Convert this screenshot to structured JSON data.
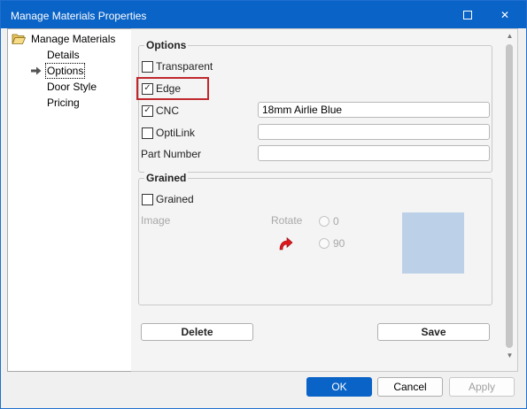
{
  "window": {
    "title": "Manage Materials Properties",
    "maximize_icon": "maximize-icon",
    "close_glyph": "✕"
  },
  "tree": {
    "root": "Manage Materials",
    "items": [
      {
        "label": "Details"
      },
      {
        "label": "Options",
        "selected": true
      },
      {
        "label": "Door Style"
      },
      {
        "label": "Pricing"
      }
    ]
  },
  "options_group": {
    "title": "Options",
    "transparent": {
      "label": "Transparent",
      "checked": false
    },
    "edge": {
      "label": "Edge",
      "checked": true
    },
    "cnc": {
      "label": "CNC",
      "checked": true,
      "value": "18mm Airlie Blue"
    },
    "optilink": {
      "label": "OptiLink",
      "checked": false,
      "value": ""
    },
    "part_number": {
      "label": "Part Number",
      "value": ""
    }
  },
  "grained_group": {
    "title": "Grained",
    "grained": {
      "label": "Grained",
      "checked": false
    },
    "image_label": "Image",
    "rotate_label": "Rotate",
    "rotate_options": [
      "0",
      "90"
    ],
    "preview_color": "#bcd1e8"
  },
  "actions": {
    "delete_label": "Delete",
    "save_label": "Save"
  },
  "footer": {
    "ok_label": "OK",
    "cancel_label": "Cancel",
    "apply_label": "Apply"
  },
  "colors": {
    "titlebar": "#0a63c6",
    "highlight": "#c0282e"
  }
}
